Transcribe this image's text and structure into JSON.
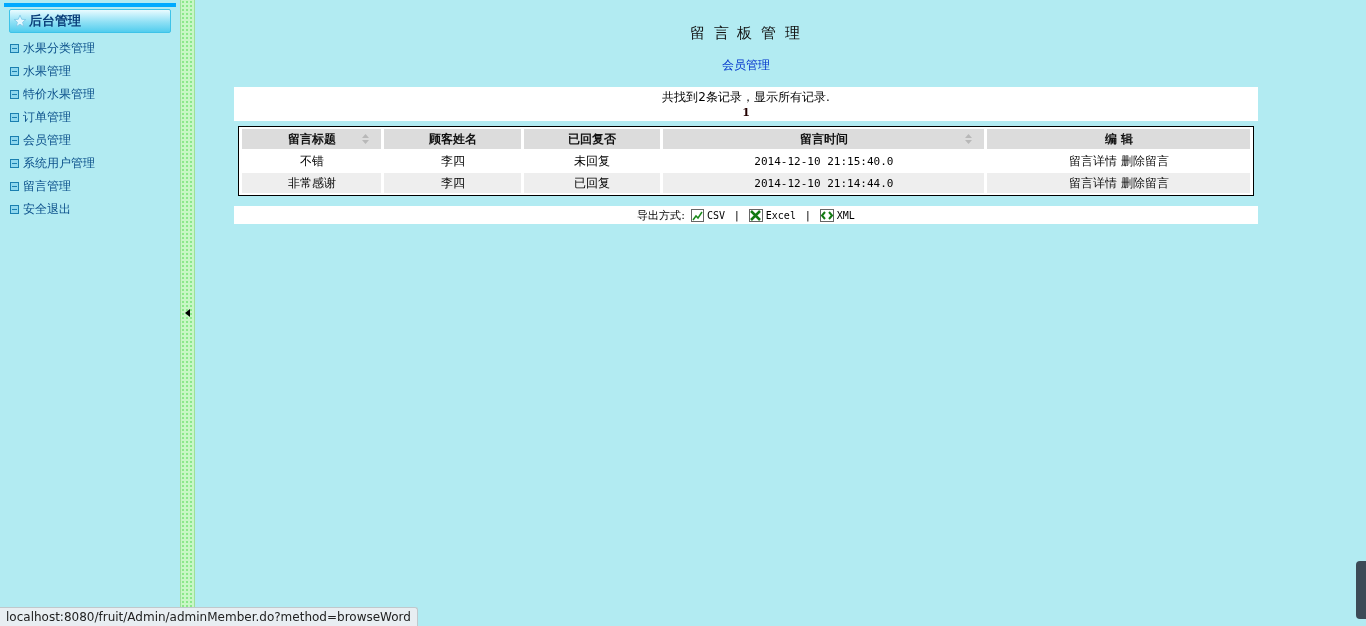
{
  "sidebar": {
    "title": "后台管理",
    "items": [
      {
        "label": "水果分类管理"
      },
      {
        "label": "水果管理"
      },
      {
        "label": "特价水果管理"
      },
      {
        "label": "订单管理"
      },
      {
        "label": "会员管理"
      },
      {
        "label": "系统用户管理"
      },
      {
        "label": "留言管理"
      },
      {
        "label": "安全退出"
      }
    ]
  },
  "page": {
    "title": "留 言 板 管 理",
    "link": "会员管理",
    "summary": "共找到2条记录，显示所有记录.",
    "pages": [
      "1"
    ]
  },
  "table": {
    "columns": [
      {
        "label": "留言标题",
        "sortable": true
      },
      {
        "label": "顾客姓名",
        "sortable": false
      },
      {
        "label": "已回复否",
        "sortable": false
      },
      {
        "label": "留言时间",
        "sortable": true
      },
      {
        "label": "编 辑",
        "sortable": false
      }
    ],
    "rows": [
      {
        "title": "不错",
        "name": "李四",
        "replied": "未回复",
        "time": "2014-12-10 21:15:40.0",
        "actions": [
          "留言详情",
          "删除留言"
        ]
      },
      {
        "title": "非常感谢",
        "name": "李四",
        "replied": "已回复",
        "time": "2014-12-10 21:14:44.0",
        "actions": [
          "留言详情",
          "删除留言"
        ]
      }
    ]
  },
  "export": {
    "label": "导出方式:",
    "separator": "|",
    "formats": [
      {
        "kind": "csv",
        "label": "CSV"
      },
      {
        "kind": "excel",
        "label": "Excel"
      },
      {
        "kind": "xml",
        "label": "XML"
      }
    ]
  },
  "status_bar": {
    "url": "localhost:8080/fruit/Admin/adminMember.do?method=browseWord"
  }
}
